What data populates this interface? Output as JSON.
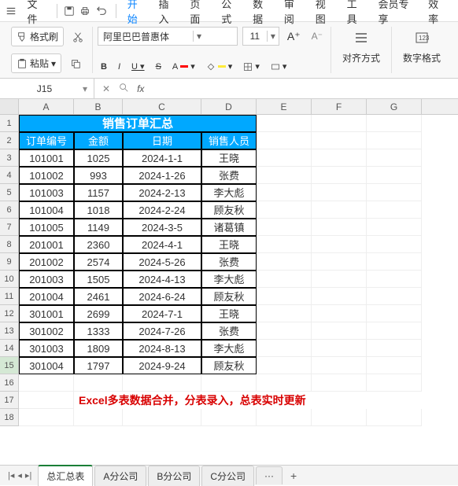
{
  "menubar": {
    "file": "文件",
    "items": [
      "开始",
      "插入",
      "页面",
      "公式",
      "数据",
      "审阅",
      "视图",
      "工具",
      "会员专享",
      "效率"
    ],
    "active_index": 0
  },
  "ribbon": {
    "format_painter": "格式刷",
    "paste": "粘贴",
    "font_name": "阿里巴巴普惠体",
    "font_size": "11",
    "align": "对齐方式",
    "number_format": "数字格式"
  },
  "formula_bar": {
    "name_box": "J15",
    "fx": "fx"
  },
  "columns": [
    "A",
    "B",
    "C",
    "D",
    "E",
    "F",
    "G"
  ],
  "table": {
    "title": "销售订单汇总",
    "headers": [
      "订单编号",
      "金额",
      "日期",
      "销售人员"
    ],
    "rows": [
      [
        "101001",
        "1025",
        "2024-1-1",
        "王晓"
      ],
      [
        "101002",
        "993",
        "2024-1-26",
        "张费"
      ],
      [
        "101003",
        "1157",
        "2024-2-13",
        "李大彪"
      ],
      [
        "101004",
        "1018",
        "2024-2-24",
        "顾友秋"
      ],
      [
        "101005",
        "1149",
        "2024-3-5",
        "诸葛镇"
      ],
      [
        "201001",
        "2360",
        "2024-4-1",
        "王晓"
      ],
      [
        "201002",
        "2574",
        "2024-5-26",
        "张费"
      ],
      [
        "201003",
        "1505",
        "2024-4-13",
        "李大彪"
      ],
      [
        "201004",
        "2461",
        "2024-6-24",
        "顾友秋"
      ],
      [
        "301001",
        "2699",
        "2024-7-1",
        "王晓"
      ],
      [
        "301002",
        "1333",
        "2024-7-26",
        "张费"
      ],
      [
        "301003",
        "1809",
        "2024-8-13",
        "李大彪"
      ],
      [
        "301004",
        "1797",
        "2024-9-24",
        "顾友秋"
      ]
    ]
  },
  "note": "Excel多表数据合并，分表录入，总表实时更新",
  "sheets": {
    "tabs": [
      "总汇总表",
      "A分公司",
      "B分公司",
      "C分公司"
    ],
    "active_index": 0,
    "more": "···",
    "add": "+"
  },
  "selected_cell": {
    "row": 15,
    "col": "J"
  }
}
